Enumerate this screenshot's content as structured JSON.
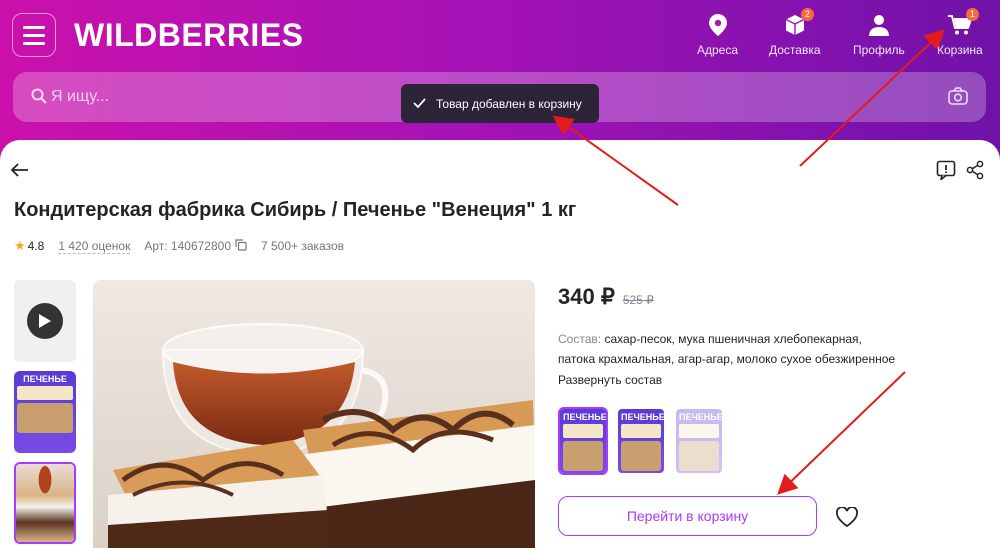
{
  "header": {
    "logo": "WILDBERRIES",
    "nav": [
      {
        "label": "Адреса",
        "icon": "location-pin-icon"
      },
      {
        "label": "Доставка",
        "icon": "box-icon",
        "badge": "2"
      },
      {
        "label": "Профиль",
        "icon": "user-icon"
      },
      {
        "label": "Корзина",
        "icon": "cart-icon",
        "badge": "1"
      }
    ],
    "search_placeholder": "Я ищу..."
  },
  "toast": {
    "text": "Товар добавлен в корзину",
    "icon": "check-icon"
  },
  "product": {
    "title": "Кондитерская фабрика Сибирь / Печенье \"Венеция\" 1 кг",
    "rating": "4.8",
    "reviews": "1 420 оценок",
    "article": "Арт: 140672800",
    "orders": "7 500+ заказов",
    "price": "340 ₽",
    "old_price": "525 ₽",
    "composition_label": "Состав:",
    "composition": "сахар-песок, мука пшеничная хлебопекарная, патока крахмальная, агар-агар, молоко сухое обезжиренное",
    "expand_label": "Развернуть состав",
    "box_label": "ПЕЧЕНЬЕ",
    "cart_button": "Перейти в корзину"
  },
  "colors": {
    "brand_gradient_start": "#cb11ab",
    "brand_gradient_end": "#6f12a8",
    "accent": "#a73afd",
    "badge": "#f56a3d"
  }
}
